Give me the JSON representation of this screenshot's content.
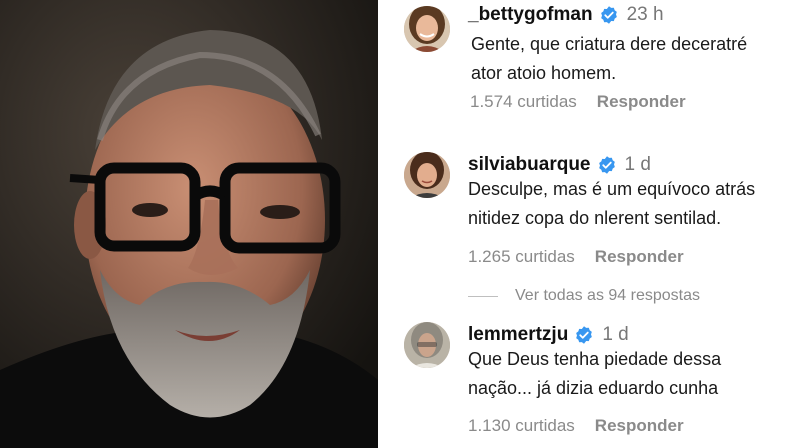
{
  "comments": [
    {
      "username": "_bettygofman",
      "verified": true,
      "time": "23 h",
      "lines": [
        "Gente, que criatura dere deceratré",
        "ator atoio homem."
      ],
      "likes": "1.574 curtidas",
      "reply": "Responder"
    },
    {
      "username": "silviabuarque",
      "verified": true,
      "time": "1 d",
      "lines": [
        "Desculpe, mas é um equívoco atrás",
        "nitidez copa do nlerent sentilad."
      ],
      "likes": "1.265 curtidas",
      "reply": "Responder"
    },
    {
      "username": "lemmertzju",
      "verified": true,
      "time": "1 d",
      "lines": [
        "Que Deus tenha piedade dessa",
        "nação... já dizia eduardo cunha"
      ],
      "likes": "1.130 curtidas",
      "reply": "Responder"
    }
  ],
  "view_replies": "Ver todas as 94 respostas",
  "colors": {
    "verified": "#3897f0",
    "muted": "#8a8a8a",
    "text": "#111111"
  },
  "icons": [
    "verified-badge-icon"
  ]
}
